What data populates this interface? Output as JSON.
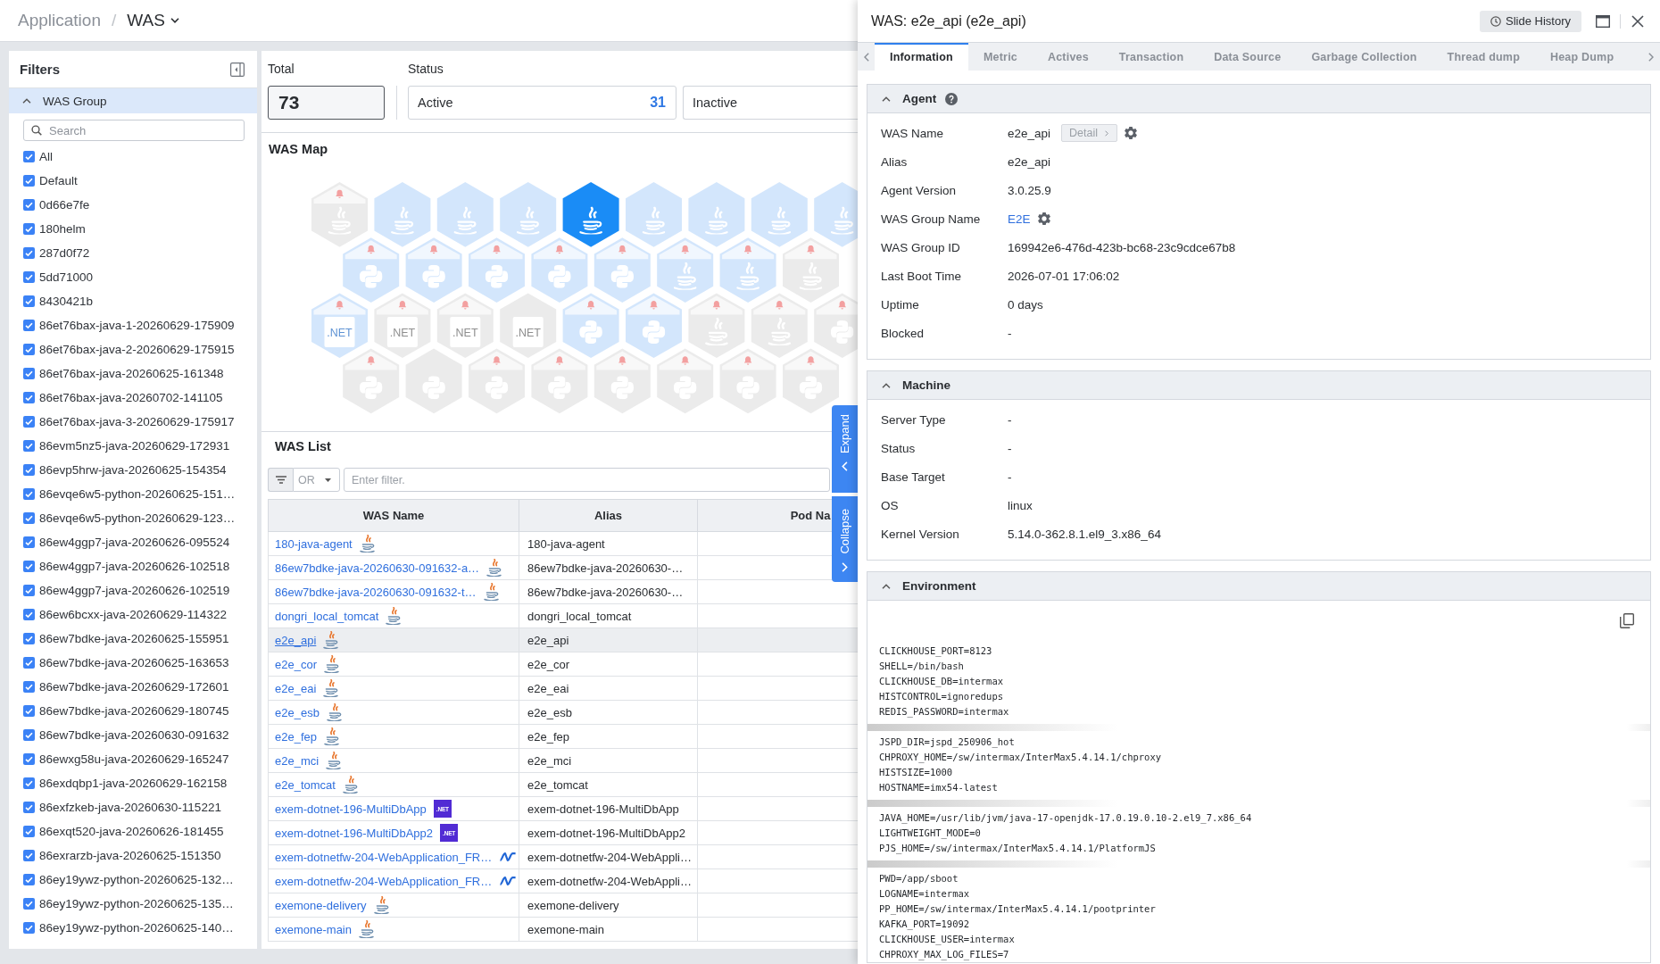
{
  "breadcrumb": {
    "items": [
      "Application",
      "WAS"
    ],
    "separator": "/"
  },
  "filters": {
    "title": "Filters",
    "group": {
      "title": "WAS Group",
      "expanded": true,
      "placeholder": "Search",
      "items": [
        {
          "label": "All",
          "checked": true
        },
        {
          "label": "Default",
          "checked": true
        },
        {
          "label": "0d66e7fe",
          "checked": true
        },
        {
          "label": "180helm",
          "checked": true
        },
        {
          "label": "287d0f72",
          "checked": true
        },
        {
          "label": "5dd71000",
          "checked": true
        },
        {
          "label": "8430421b",
          "checked": true
        },
        {
          "label": "86et76bax-java-1-20260629-175909",
          "checked": true
        },
        {
          "label": "86et76bax-java-2-20260629-175915",
          "checked": true
        },
        {
          "label": "86et76bax-java-20260625-161348",
          "checked": true
        },
        {
          "label": "86et76bax-java-20260702-141105",
          "checked": true
        },
        {
          "label": "86et76bax-java-3-20260629-175917",
          "checked": true
        },
        {
          "label": "86evm5nz5-java-20260629-172931",
          "checked": true
        },
        {
          "label": "86evp5hrw-java-20260625-154354",
          "checked": true
        },
        {
          "label": "86evqe6w5-python-20260625-151…",
          "checked": true
        },
        {
          "label": "86evqe6w5-python-20260629-123…",
          "checked": true
        },
        {
          "label": "86ew4ggp7-java-20260626-095524",
          "checked": true
        },
        {
          "label": "86ew4ggp7-java-20260626-102518",
          "checked": true
        },
        {
          "label": "86ew4ggp7-java-20260626-102519",
          "checked": true
        },
        {
          "label": "86ew6bcxx-java-20260629-114322",
          "checked": true
        },
        {
          "label": "86ew7bdke-java-20260625-155951",
          "checked": true
        },
        {
          "label": "86ew7bdke-java-20260625-163653",
          "checked": true
        },
        {
          "label": "86ew7bdke-java-20260629-172601",
          "checked": true
        },
        {
          "label": "86ew7bdke-java-20260629-180745",
          "checked": true
        },
        {
          "label": "86ew7bdke-java-20260630-091632",
          "checked": true
        },
        {
          "label": "86ewxg58u-java-20260629-165247",
          "checked": true
        },
        {
          "label": "86exdqbp1-java-20260629-162158",
          "checked": true
        },
        {
          "label": "86exfzkeb-java-20260630-115221",
          "checked": true
        },
        {
          "label": "86exqt520-java-20260626-181455",
          "checked": true
        },
        {
          "label": "86exrarzb-java-20260625-151350",
          "checked": true
        },
        {
          "label": "86ey19ywz-python-20260625-132…",
          "checked": true
        },
        {
          "label": "86ey19ywz-python-20260625-135…",
          "checked": true
        },
        {
          "label": "86ey19ywz-python-20260625-140…",
          "checked": true
        }
      ]
    }
  },
  "summary": {
    "total": {
      "label": "Total",
      "value": "73"
    },
    "status": {
      "label": "Status",
      "items": [
        {
          "label": "Active",
          "count": "31"
        },
        {
          "label": "Inactive"
        }
      ]
    }
  },
  "was_map": {
    "title": "WAS Map",
    "rows": [
      [
        {
          "kind": "java",
          "active": false,
          "alert": true,
          "selected": false
        },
        {
          "kind": "java",
          "active": true,
          "alert": false,
          "selected": false
        },
        {
          "kind": "java",
          "active": true,
          "alert": false,
          "selected": false
        },
        {
          "kind": "java",
          "active": true,
          "alert": false,
          "selected": false
        },
        {
          "kind": "java",
          "active": true,
          "alert": false,
          "selected": true
        },
        {
          "kind": "java",
          "active": true,
          "alert": false,
          "selected": false
        },
        {
          "kind": "java",
          "active": true,
          "alert": false,
          "selected": false
        },
        {
          "kind": "java",
          "active": true,
          "alert": false,
          "selected": false
        },
        {
          "kind": "java",
          "active": true,
          "alert": false,
          "selected": false
        }
      ],
      [
        {
          "kind": "python",
          "active": true,
          "alert": true,
          "selected": false
        },
        {
          "kind": "python",
          "active": true,
          "alert": true,
          "selected": false
        },
        {
          "kind": "python",
          "active": true,
          "alert": true,
          "selected": false
        },
        {
          "kind": "python",
          "active": true,
          "alert": true,
          "selected": false
        },
        {
          "kind": "python",
          "active": true,
          "alert": true,
          "selected": false
        },
        {
          "kind": "java",
          "active": true,
          "alert": true,
          "selected": false
        },
        {
          "kind": "java",
          "active": true,
          "alert": true,
          "selected": false
        },
        {
          "kind": "java",
          "active": false,
          "alert": true,
          "selected": false
        }
      ],
      [
        {
          "kind": "dotnet",
          "logo_text": ".NET",
          "active": true,
          "alert": true,
          "selected": false
        },
        {
          "kind": "dotnet",
          "logo_text": ".NET",
          "active": false,
          "alert": true,
          "selected": false
        },
        {
          "kind": "dotnet",
          "logo_text": ".NET",
          "active": false,
          "alert": true,
          "selected": false
        },
        {
          "kind": "dotnet",
          "logo_text": ".NET",
          "active": false,
          "alert": false,
          "selected": false
        },
        {
          "kind": "python",
          "active": true,
          "alert": true,
          "selected": false
        },
        {
          "kind": "python",
          "active": true,
          "alert": true,
          "selected": false
        },
        {
          "kind": "java",
          "active": false,
          "alert": true,
          "selected": false
        },
        {
          "kind": "java",
          "active": false,
          "alert": true,
          "selected": false
        },
        {
          "kind": "python",
          "active": false,
          "alert": true,
          "selected": false
        }
      ],
      [
        {
          "kind": "python",
          "active": false,
          "alert": true,
          "selected": false
        },
        {
          "kind": "python",
          "active": false,
          "alert": false,
          "selected": false
        },
        {
          "kind": "python",
          "active": false,
          "alert": true,
          "selected": false
        },
        {
          "kind": "python",
          "active": false,
          "alert": true,
          "selected": false
        },
        {
          "kind": "python",
          "active": false,
          "alert": true,
          "selected": false
        },
        {
          "kind": "python",
          "active": false,
          "alert": true,
          "selected": false
        },
        {
          "kind": "python",
          "active": false,
          "alert": true,
          "selected": false
        },
        {
          "kind": "python",
          "active": false,
          "alert": true,
          "selected": false
        }
      ]
    ]
  },
  "was_list": {
    "title": "WAS List",
    "filter": {
      "operator": "OR",
      "placeholder": "Enter filter."
    },
    "columns": [
      "WAS Name",
      "Alias",
      "Pod Na"
    ],
    "rows": [
      {
        "name": "180-java-agent",
        "kind": "java",
        "alias": "180-java-agent",
        "selected": false
      },
      {
        "name": "86ew7bdke-java-20260630-091632-a…",
        "kind": "java",
        "alias": "86ew7bdke-java-20260630-…",
        "selected": false
      },
      {
        "name": "86ew7bdke-java-20260630-091632-t…",
        "kind": "java",
        "alias": "86ew7bdke-java-20260630-…",
        "selected": false
      },
      {
        "name": "dongri_local_tomcat",
        "kind": "java",
        "alias": "dongri_local_tomcat",
        "selected": false
      },
      {
        "name": "e2e_api",
        "kind": "java",
        "alias": "e2e_api",
        "selected": true
      },
      {
        "name": "e2e_cor",
        "kind": "java",
        "alias": "e2e_cor",
        "selected": false
      },
      {
        "name": "e2e_eai",
        "kind": "java",
        "alias": "e2e_eai",
        "selected": false
      },
      {
        "name": "e2e_esb",
        "kind": "java",
        "alias": "e2e_esb",
        "selected": false
      },
      {
        "name": "e2e_fep",
        "kind": "java",
        "alias": "e2e_fep",
        "selected": false
      },
      {
        "name": "e2e_mci",
        "kind": "java",
        "alias": "e2e_mci",
        "selected": false
      },
      {
        "name": "e2e_tomcat",
        "kind": "java",
        "alias": "e2e_tomcat",
        "selected": false
      },
      {
        "name": "exem-dotnet-196-MultiDbApp",
        "kind": "dotnet",
        "badge": ".NET",
        "alias": "exem-dotnet-196-MultiDbApp",
        "selected": false
      },
      {
        "name": "exem-dotnet-196-MultiDbApp2",
        "kind": "dotnet",
        "badge": ".NET",
        "alias": "exem-dotnet-196-MultiDbApp2",
        "selected": false
      },
      {
        "name": "exem-dotnetfw-204-WebApplication_FR…",
        "kind": "dotnetfw",
        "alias": "exem-dotnetfw-204-WebAppli…",
        "selected": false
      },
      {
        "name": "exem-dotnetfw-204-WebApplication_FR…",
        "kind": "dotnetfw",
        "alias": "exem-dotnetfw-204-WebAppli…",
        "selected": false
      },
      {
        "name": "exemone-delivery",
        "kind": "java",
        "alias": "exemone-delivery",
        "selected": false
      },
      {
        "name": "exemone-main",
        "kind": "java",
        "alias": "exemone-main",
        "selected": false
      }
    ]
  },
  "side_toggle": [
    {
      "label": "Expand",
      "kind": "expand"
    },
    {
      "label": "Collapse",
      "kind": "collapse"
    }
  ],
  "detail": {
    "title": "WAS: e2e_api (e2e_api)",
    "slide_history": "Slide History",
    "tabs": [
      {
        "label": "Information",
        "selected": true
      },
      {
        "label": "Metric",
        "selected": false
      },
      {
        "label": "Actives",
        "selected": false
      },
      {
        "label": "Transaction",
        "selected": false
      },
      {
        "label": "Data Source",
        "selected": false
      },
      {
        "label": "Garbage Collection",
        "selected": false
      },
      {
        "label": "Thread dump",
        "selected": false
      },
      {
        "label": "Heap Dump",
        "selected": false
      }
    ],
    "sections": [
      {
        "kind": "fields",
        "title": "Agent",
        "expanded": true,
        "help": true,
        "fields": [
          {
            "label": "WAS Name",
            "value": "e2e_api",
            "kind": "text",
            "detail_button": "Detail",
            "settings": true
          },
          {
            "label": "Alias",
            "value": "e2e_api",
            "kind": "text"
          },
          {
            "label": "Agent Version",
            "value": "3.0.25.9",
            "kind": "text"
          },
          {
            "label": "WAS Group Name",
            "value": "E2E",
            "kind": "link",
            "settings": true
          },
          {
            "label": "WAS Group ID",
            "value": "169942e6-476d-423b-bc68-23c9cdce67b8",
            "kind": "text"
          },
          {
            "label": "Last Boot Time",
            "value": "2026-07-01 17:06:02",
            "kind": "text"
          },
          {
            "label": "Uptime",
            "value": "0 days",
            "kind": "text"
          },
          {
            "label": "Blocked",
            "value": "-",
            "kind": "text"
          }
        ]
      },
      {
        "kind": "fields",
        "title": "Machine",
        "expanded": true,
        "fields": [
          {
            "label": "Server Type",
            "value": "-",
            "kind": "text"
          },
          {
            "label": "Status",
            "value": "-",
            "kind": "text"
          },
          {
            "label": "Base Target",
            "value": "-",
            "kind": "text"
          },
          {
            "label": "OS",
            "value": "linux",
            "kind": "text"
          },
          {
            "label": "Kernel Version",
            "value": "5.14.0-362.8.1.el9_3.x86_64",
            "kind": "text"
          }
        ]
      },
      {
        "kind": "environment",
        "title": "Environment",
        "expanded": true,
        "groups": [
          [
            "CLICKHOUSE_PORT=8123",
            "SHELL=/bin/bash",
            "CLICKHOUSE_DB=intermax",
            "HISTCONTROL=ignoredups",
            "REDIS_PASSWORD=intermax"
          ],
          [
            "JSPD_DIR=jspd_250906_hot",
            "CHPROXY_HOME=/sw/intermax/InterMax5.4.14.1/chproxy",
            "HISTSIZE=1000",
            "HOSTNAME=imx54-latest"
          ],
          [
            "JAVA_HOME=/usr/lib/jvm/java-17-openjdk-17.0.19.0.10-2.el9_7.x86_64",
            "LIGHTWEIGHT_MODE=0",
            "PJS_HOME=/sw/intermax/InterMax5.4.14.1/PlatformJS"
          ],
          [
            "PWD=/app/sboot",
            "LOGNAME=intermax",
            "PP_HOME=/sw/intermax/InterMax5.4.14.1/pootprinter",
            "KAFKA_PORT=19092",
            "CLICKHOUSE_USER=intermax",
            "CHPROXY_MAX_LOG_FILES=7"
          ]
        ]
      }
    ]
  }
}
